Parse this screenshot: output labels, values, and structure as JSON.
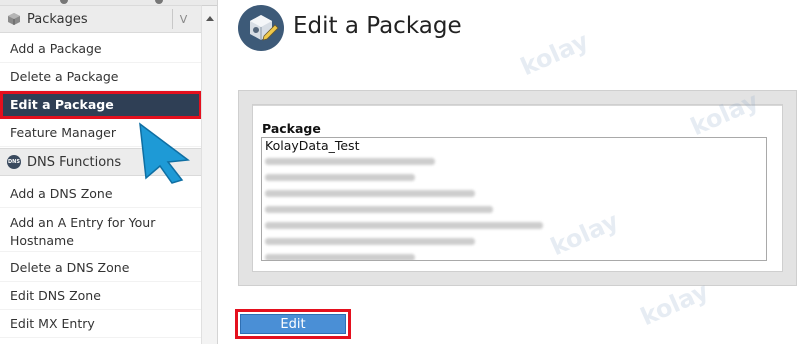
{
  "sidebar": {
    "packages_header": {
      "label": "Packages",
      "collapse_glyph": "V",
      "icon": "package-icon"
    },
    "packages_items": [
      {
        "label": "Add a Package"
      },
      {
        "label": "Delete a Package"
      },
      {
        "label": "Edit a Package",
        "active": true
      },
      {
        "label": "Feature Manager"
      }
    ],
    "dns_header": {
      "label": "DNS Functions",
      "badge": "DNS",
      "icon": "dns-icon"
    },
    "dns_items": [
      {
        "label": "Add a DNS Zone"
      },
      {
        "label": "Add an A Entry for Your Hostname"
      },
      {
        "label": "Delete a DNS Zone"
      },
      {
        "label": "Edit DNS Zone"
      },
      {
        "label": "Edit MX Entry"
      }
    ]
  },
  "main": {
    "page_title": "Edit a Package",
    "page_icon": "edit-package-icon",
    "package_field": {
      "label": "Package",
      "visible_option": "KolayData_Test",
      "blurred_option_count": 7
    },
    "edit_button_label": "Edit"
  },
  "watermark_text": "kolay",
  "colors": {
    "accent_red": "#e4101e",
    "active_nav_bg": "#2f3f55",
    "button_blue": "#4a8fd6",
    "cursor_blue": "#1e9ad6"
  }
}
